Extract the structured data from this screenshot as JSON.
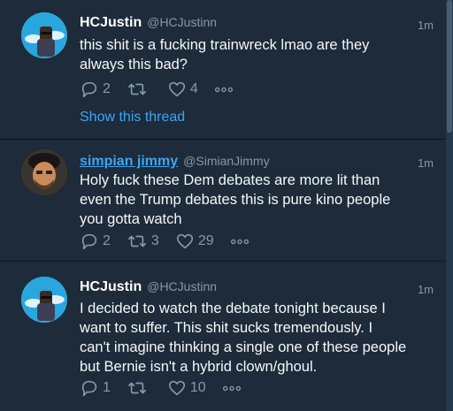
{
  "tweets": [
    {
      "name": "HCJustin",
      "handle": "@HCJustinn",
      "time": "1m",
      "lines": [
        "this shit is a fucking trainwreck lmao are they",
        "always this bad?"
      ],
      "replies": "2",
      "retweets": "",
      "likes": "4",
      "show_thread": "Show this thread"
    },
    {
      "name": "simpian jimmy",
      "handle": "@SimianJimmy",
      "time": "1m",
      "lines": [
        "Holy fuck these Dem debates are more lit than",
        "even the Trump debates this is pure kino people",
        "you gotta watch"
      ],
      "replies": "2",
      "retweets": "3",
      "likes": "29"
    },
    {
      "name": "HCJustin",
      "handle": "@HCJustinn",
      "time": "1m",
      "lines": [
        "I decided to watch the debate tonight because I",
        "want to suffer.  This shit sucks tremendously.  I",
        "can't imagine thinking a single one of these people",
        "but Bernie isn't a hybrid clown/ghoul."
      ],
      "replies": "1",
      "retweets": "",
      "likes": "10"
    }
  ],
  "colors": {
    "background": "#1d2b3a",
    "accent": "#3ea6f2",
    "muted": "#8899a6"
  },
  "icons": [
    "reply-icon",
    "retweet-icon",
    "like-icon",
    "more-icon"
  ]
}
